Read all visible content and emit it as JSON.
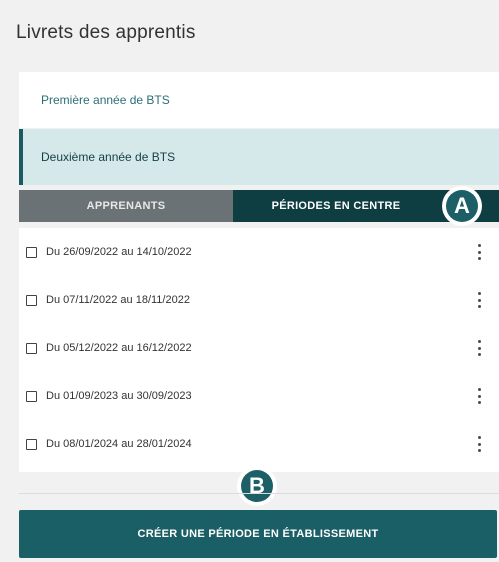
{
  "header": {
    "title": "Livrets des apprentis"
  },
  "years": [
    {
      "label": "Première année de BTS",
      "selected": false
    },
    {
      "label": "Deuxième année de BTS",
      "selected": true
    }
  ],
  "tabs": [
    {
      "label": "APPRENANTS",
      "active": false
    },
    {
      "label": "PÉRIODES EN CENTRE",
      "active": true
    }
  ],
  "markers": {
    "a": "A",
    "b": "B"
  },
  "periods": [
    {
      "label": "Du 26/09/2022 au 14/10/2022",
      "checked": false
    },
    {
      "label": "Du 07/11/2022 au 18/11/2022",
      "checked": false
    },
    {
      "label": "Du 05/12/2022 au 16/12/2022",
      "checked": false
    },
    {
      "label": "Du 01/09/2023 au 30/09/2023",
      "checked": false
    },
    {
      "label": "Du 08/01/2024 au 28/01/2024",
      "checked": false
    }
  ],
  "actions": {
    "create_label": "CRÉER UNE PÉRIODE EN ÉTABLISSEMENT"
  },
  "colors": {
    "accent": "#1a5e66",
    "active_tab": "#0f3e42",
    "inactive_tab": "#6b7275",
    "selected_year_bg": "#d5e8ea"
  },
  "icons": {
    "row_menu": "kebab-menu-icon",
    "row_select": "checkbox-icon"
  }
}
